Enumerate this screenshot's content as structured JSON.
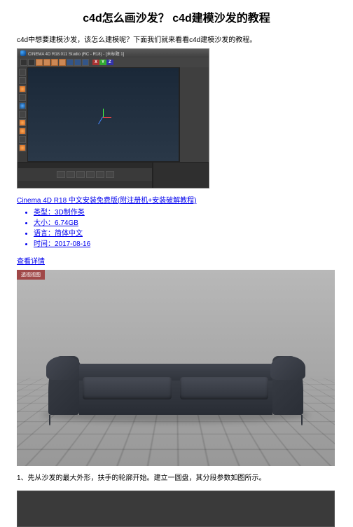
{
  "page": {
    "title": "c4d怎么画沙发？ c4d建模沙发的教程",
    "intro": "c4d中想要建模沙发，该怎么建模呢？下面我们就来看看c4d建模沙发的教程。",
    "download_link": "Cinema 4D R18 中文安装免费版(附注册机+安装破解教程)",
    "meta": {
      "type_label": "类型：",
      "type_value": "3D制作类",
      "size_label": "大小：",
      "size_value": "6.74GB",
      "lang_label": "语言：",
      "lang_value": "简体中文",
      "time_label": "时间：",
      "time_value": "2017-08-16"
    },
    "detail_link": "查看详情",
    "step1": "1、先从沙发的最大外形，扶手的轮廓开始。建立一圆盘，其分段参数如图所示。"
  },
  "c4d": {
    "title": "CINEMA 4D R18.011 Studio (RC - R18) - [未标题 1]",
    "xyz": {
      "x": "X",
      "y": "Y",
      "z": "Z"
    }
  },
  "sc2": {
    "tab": "透视视图"
  }
}
